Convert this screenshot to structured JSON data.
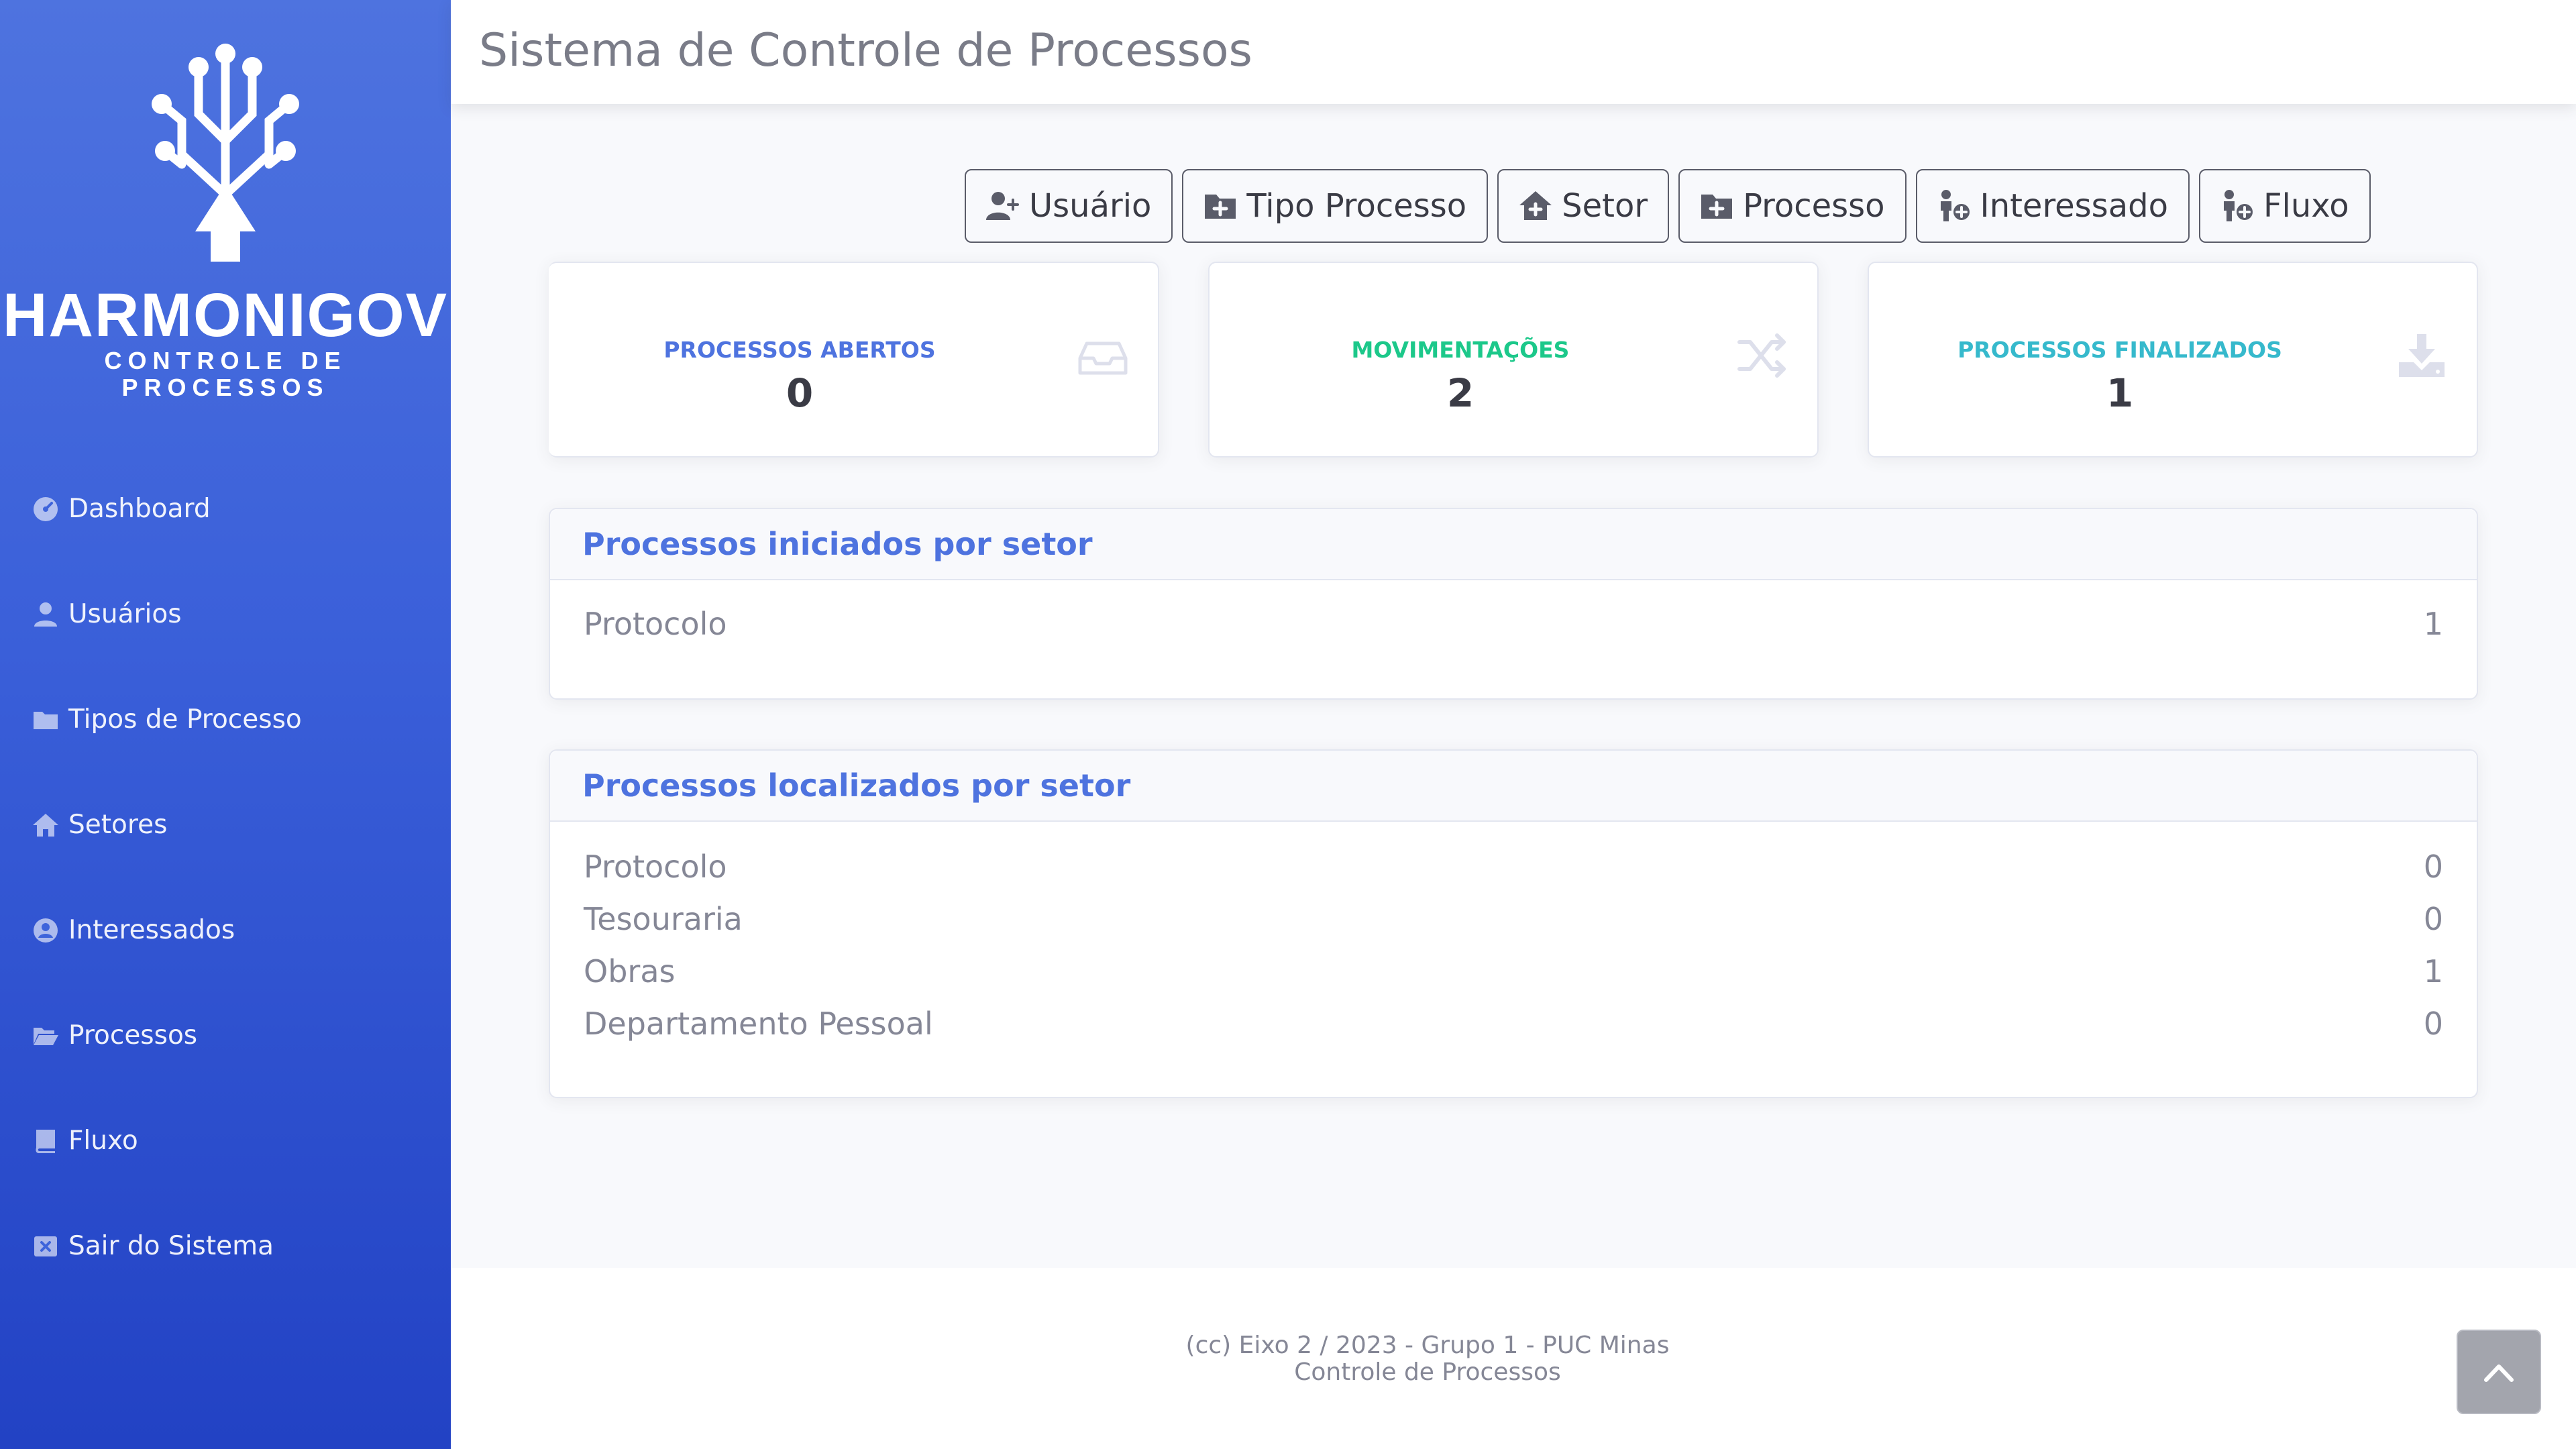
{
  "logo": {
    "title": "HARMONIGOV",
    "subtitle": "CONTROLE DE PROCESSOS"
  },
  "sidebar": {
    "items": [
      {
        "label": "Dashboard",
        "icon": "dashboard-icon"
      },
      {
        "label": "Usuários",
        "icon": "user-icon"
      },
      {
        "label": "Tipos de Processo",
        "icon": "folder-icon"
      },
      {
        "label": "Setores",
        "icon": "home-icon"
      },
      {
        "label": "Interessados",
        "icon": "user-circle-icon"
      },
      {
        "label": "Processos",
        "icon": "folder-open-icon"
      },
      {
        "label": "Fluxo",
        "icon": "book-icon"
      },
      {
        "label": "Sair do Sistema",
        "icon": "close-square-icon"
      }
    ]
  },
  "header": {
    "title": "Sistema de Controle de Processos"
  },
  "actions": {
    "usuario": "Usuário",
    "tipo_processo": "Tipo Processo",
    "setor": "Setor",
    "processo": "Processo",
    "interessado": "Interessado",
    "fluxo": "Fluxo"
  },
  "stats": [
    {
      "label": "PROCESSOS ABERTOS",
      "value": "0",
      "color": "#4e73df",
      "icon": "inbox-icon"
    },
    {
      "label": "MOVIMENTAÇÕES",
      "value": "2",
      "color": "#1cc88a",
      "icon": "shuffle-icon"
    },
    {
      "label": "PROCESSOS FINALIZADOS",
      "value": "1",
      "color": "#36b9cc",
      "icon": "download-icon"
    }
  ],
  "panels": {
    "iniciados": {
      "title": "Processos iniciados por setor",
      "rows": [
        {
          "name": "Protocolo",
          "count": "1"
        }
      ]
    },
    "localizados": {
      "title": "Processos localizados por setor",
      "rows": [
        {
          "name": "Protocolo",
          "count": "0"
        },
        {
          "name": "Tesouraria",
          "count": "0"
        },
        {
          "name": "Obras",
          "count": "1"
        },
        {
          "name": "Departamento Pessoal",
          "count": "0"
        }
      ]
    }
  },
  "footer": {
    "line1": "(cc) Eixo 2 / 2023 - Grupo 1 - PUC Minas",
    "line2": "Controle de Processos"
  }
}
